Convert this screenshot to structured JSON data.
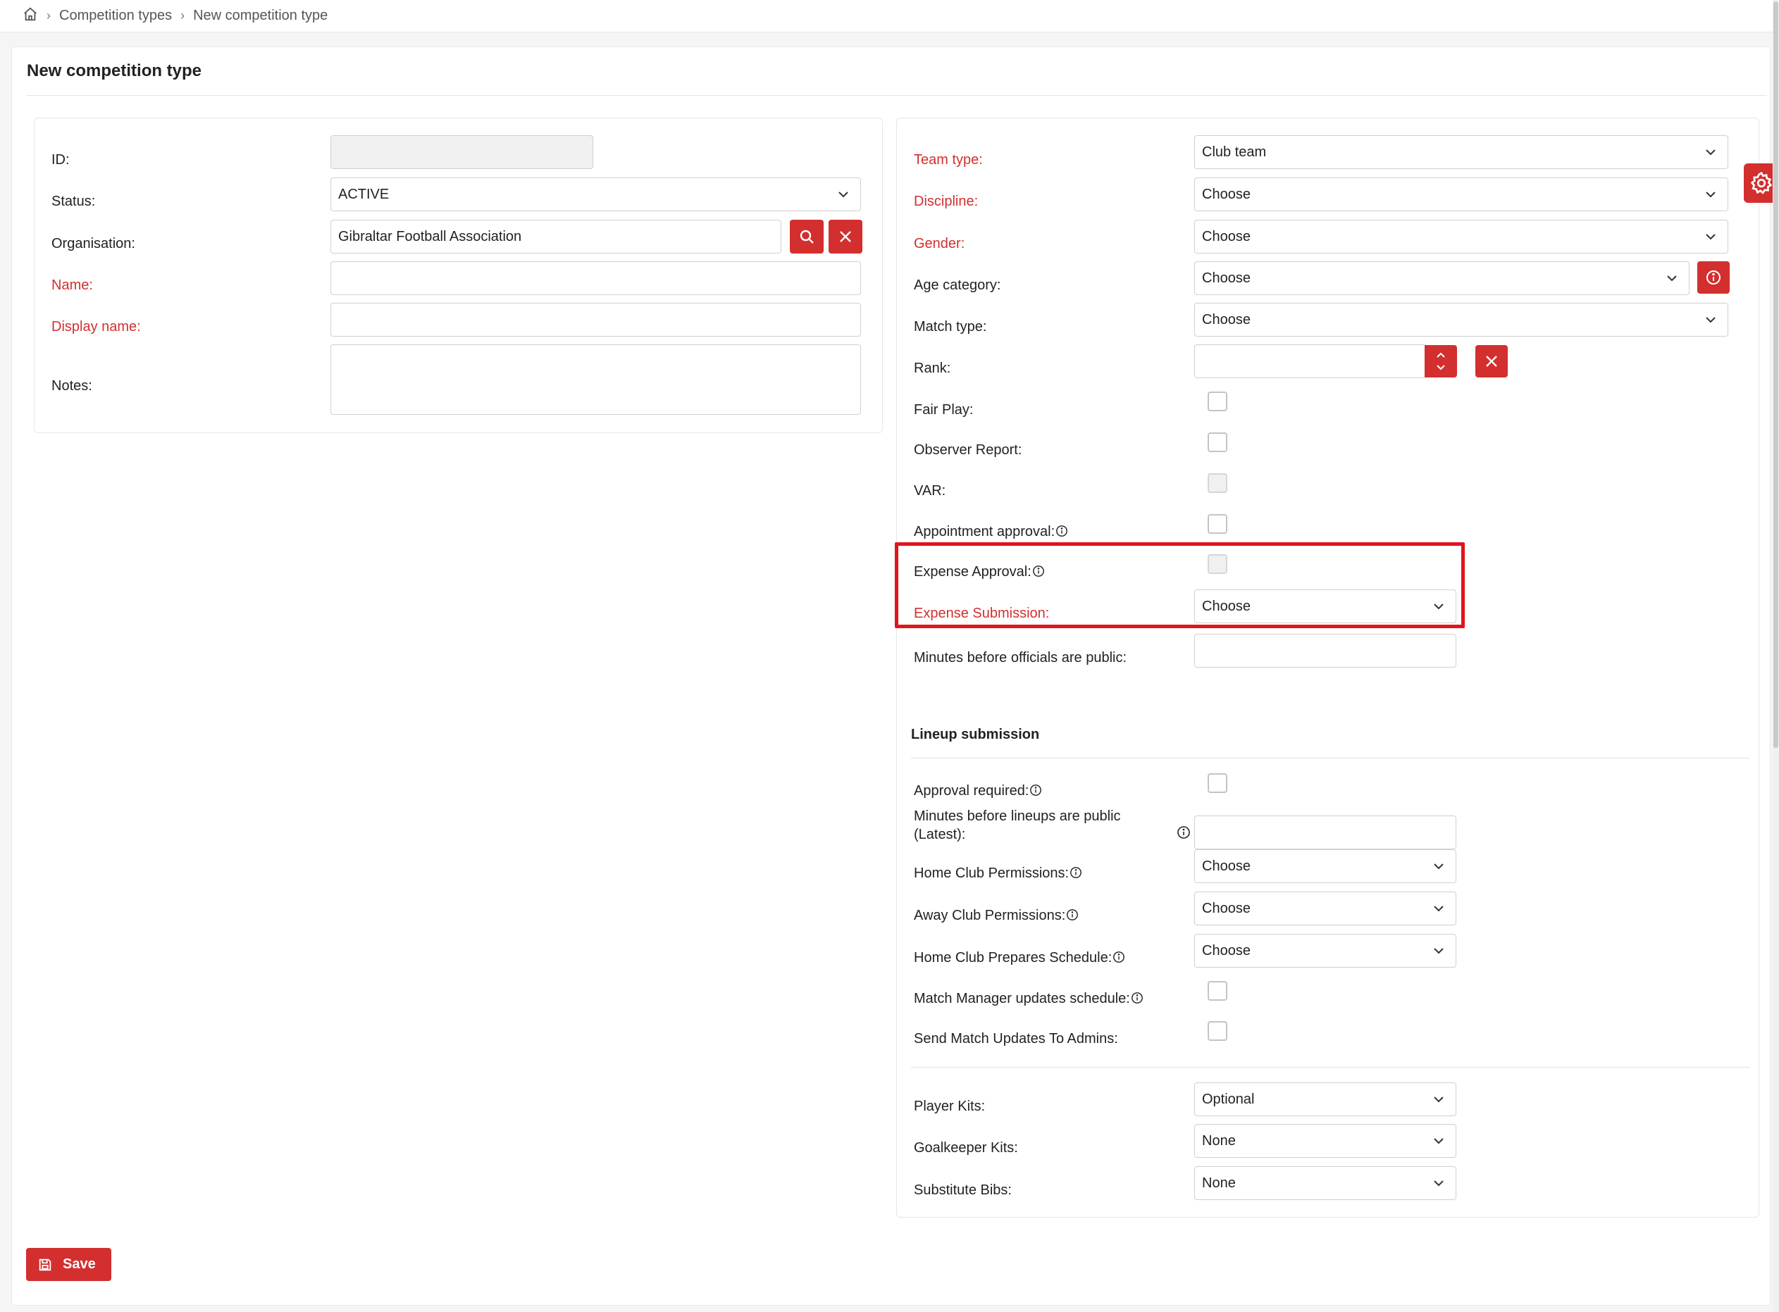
{
  "breadcrumb": {
    "home_icon": "home-icon",
    "items": [
      "Competition types",
      "New competition type"
    ]
  },
  "page": {
    "title": "New competition type",
    "save_label": "Save"
  },
  "left_form": {
    "id_label": "ID:",
    "id_value": "",
    "status_label": "Status:",
    "status_value": "ACTIVE",
    "organisation_label": "Organisation:",
    "organisation_value": "Gibraltar Football Association",
    "name_label": "Name:",
    "name_value": "",
    "display_name_label": "Display name:",
    "display_name_value": "",
    "notes_label": "Notes:"
  },
  "right_form": {
    "team_type_label": "Team type:",
    "team_type_value": "Club team",
    "discipline_label": "Discipline:",
    "discipline_value": "Choose",
    "gender_label": "Gender:",
    "gender_value": "Choose",
    "age_category_label": "Age category:",
    "age_category_value": "Choose",
    "match_type_label": "Match type:",
    "match_type_value": "Choose",
    "rank_label": "Rank:",
    "fair_play_label": "Fair Play:",
    "observer_report_label": "Observer Report:",
    "var_label": "VAR:",
    "appointment_approval_label": "Appointment approval:",
    "expense_approval_label": "Expense Approval:",
    "expense_submission_label": "Expense Submission:",
    "expense_submission_value": "Choose",
    "minutes_officials_label": "Minutes before officials are public:"
  },
  "lineup": {
    "title": "Lineup submission",
    "approval_required_label": "Approval required:",
    "minutes_lineups_label_1": "Minutes before lineups are public",
    "minutes_lineups_label_2": "(Latest):",
    "home_club_permissions_label": "Home Club Permissions:",
    "home_club_permissions_value": "Choose",
    "away_club_permissions_label": "Away Club Permissions:",
    "away_club_permissions_value": "Choose",
    "home_club_prepares_label": "Home Club Prepares Schedule:",
    "home_club_prepares_value": "Choose",
    "match_manager_label": "Match Manager updates schedule:",
    "send_updates_label": "Send Match Updates To Admins:"
  },
  "kits": {
    "player_kits_label": "Player Kits:",
    "player_kits_value": "Optional",
    "goalkeeper_kits_label": "Goalkeeper Kits:",
    "goalkeeper_kits_value": "None",
    "substitute_bibs_label": "Substitute Bibs:",
    "substitute_bibs_value": "None"
  },
  "colors": {
    "accent": "#d32f2f",
    "required_label": "#d32f2f",
    "highlight_box": "#e0141b"
  }
}
